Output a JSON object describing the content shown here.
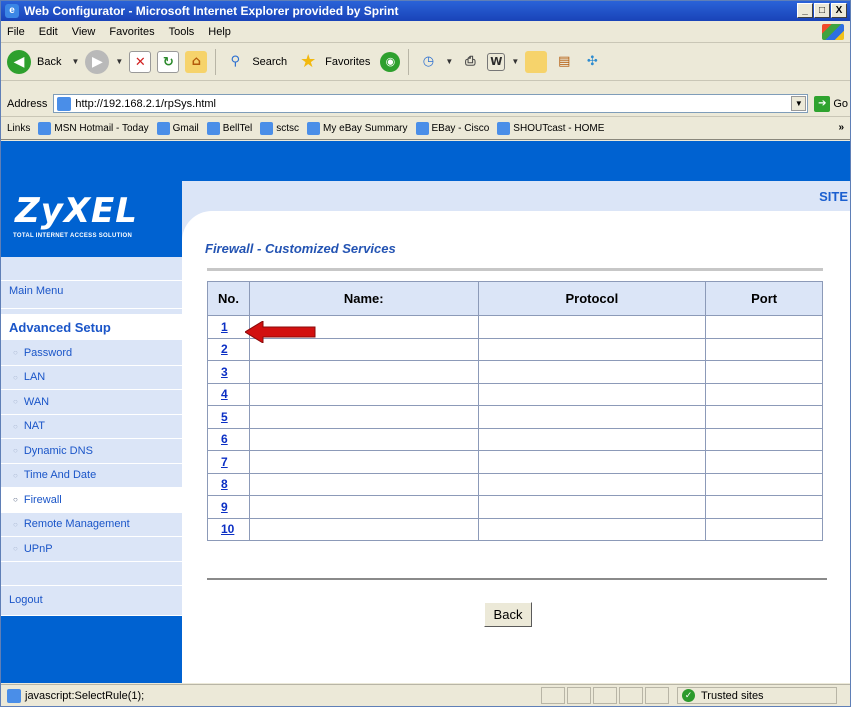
{
  "window": {
    "title": "Web Configurator - Microsoft Internet Explorer provided by Sprint",
    "min_label": "_",
    "max_label": "□",
    "close_label": "X"
  },
  "menu": [
    "File",
    "Edit",
    "View",
    "Favorites",
    "Tools",
    "Help"
  ],
  "toolbar": {
    "back": "Back",
    "search": "Search",
    "favorites": "Favorites"
  },
  "address": {
    "label": "Address",
    "url": "http://192.168.2.1/rpSys.html",
    "go": "Go"
  },
  "links": {
    "label": "Links",
    "items": [
      "MSN Hotmail - Today",
      "Gmail",
      "BellTel",
      "sctsc",
      "My eBay Summary",
      "EBay - Cisco",
      "SHOUTcast - HOME"
    ]
  },
  "brand": {
    "logo": "ZyXEL",
    "tagline": "TOTAL INTERNET ACCESS SOLUTION",
    "site": "SITE"
  },
  "sidebar": {
    "main_menu": "Main Menu",
    "section": "Advanced Setup",
    "items": [
      "Password",
      "LAN",
      "WAN",
      "NAT",
      "Dynamic DNS",
      "Time And Date",
      "Firewall",
      "Remote Management",
      "UPnP"
    ],
    "active": "Firewall",
    "logout": "Logout"
  },
  "page": {
    "title": "Firewall - Customized Services",
    "columns": [
      "No.",
      "Name:",
      "Protocol",
      "Port"
    ],
    "rows": [
      {
        "no": "1",
        "name": "",
        "protocol": "",
        "port": ""
      },
      {
        "no": "2",
        "name": "",
        "protocol": "",
        "port": ""
      },
      {
        "no": "3",
        "name": "",
        "protocol": "",
        "port": ""
      },
      {
        "no": "4",
        "name": "",
        "protocol": "",
        "port": ""
      },
      {
        "no": "5",
        "name": "",
        "protocol": "",
        "port": ""
      },
      {
        "no": "6",
        "name": "",
        "protocol": "",
        "port": ""
      },
      {
        "no": "7",
        "name": "",
        "protocol": "",
        "port": ""
      },
      {
        "no": "8",
        "name": "",
        "protocol": "",
        "port": ""
      },
      {
        "no": "9",
        "name": "",
        "protocol": "",
        "port": ""
      },
      {
        "no": "10",
        "name": "",
        "protocol": "",
        "port": ""
      }
    ],
    "back_button": "Back"
  },
  "status": {
    "text": "javascript:SelectRule(1);",
    "zone": "Trusted sites"
  },
  "colors": {
    "brand_blue": "#0062d1",
    "light_panel": "#dbe5f7",
    "arrow_red": "#d21010"
  }
}
